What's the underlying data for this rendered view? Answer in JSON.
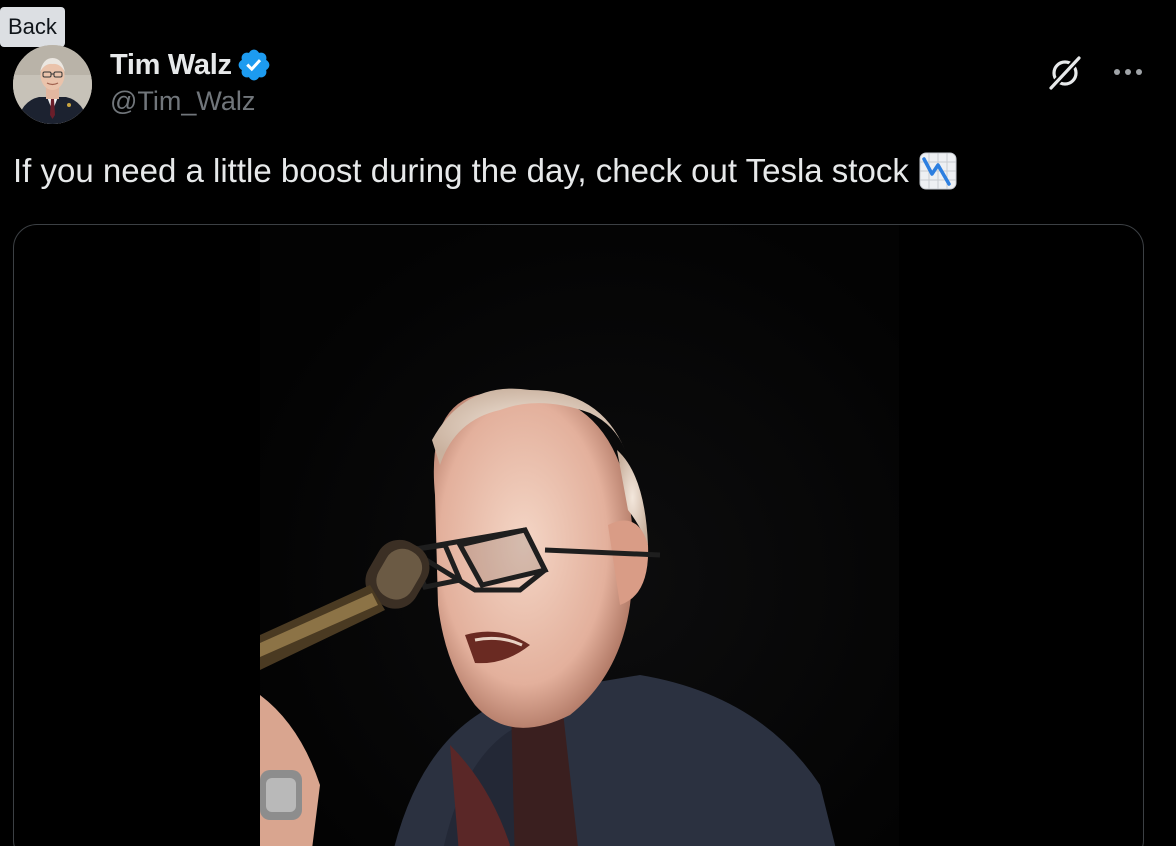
{
  "tooltip": {
    "back_label": "Back"
  },
  "author": {
    "name": "Tim Walz",
    "handle": "@Tim_Walz",
    "verified": true,
    "avatar_icon": "person-portrait"
  },
  "actions": {
    "grok_icon": "grok-icon",
    "more_icon": "more-horizontal-icon"
  },
  "tweet": {
    "text": "If you need a little boost during the day, check out Tesla stock",
    "emoji_icon": "chart-decreasing-emoji"
  },
  "media": {
    "type": "video",
    "content": "man with glasses speaking into a microphone"
  },
  "colors": {
    "background": "#000000",
    "text_primary": "#e7e9ea",
    "text_secondary": "#71767b",
    "verified_blue": "#1d9bf0",
    "card_border": "#3c4044"
  }
}
